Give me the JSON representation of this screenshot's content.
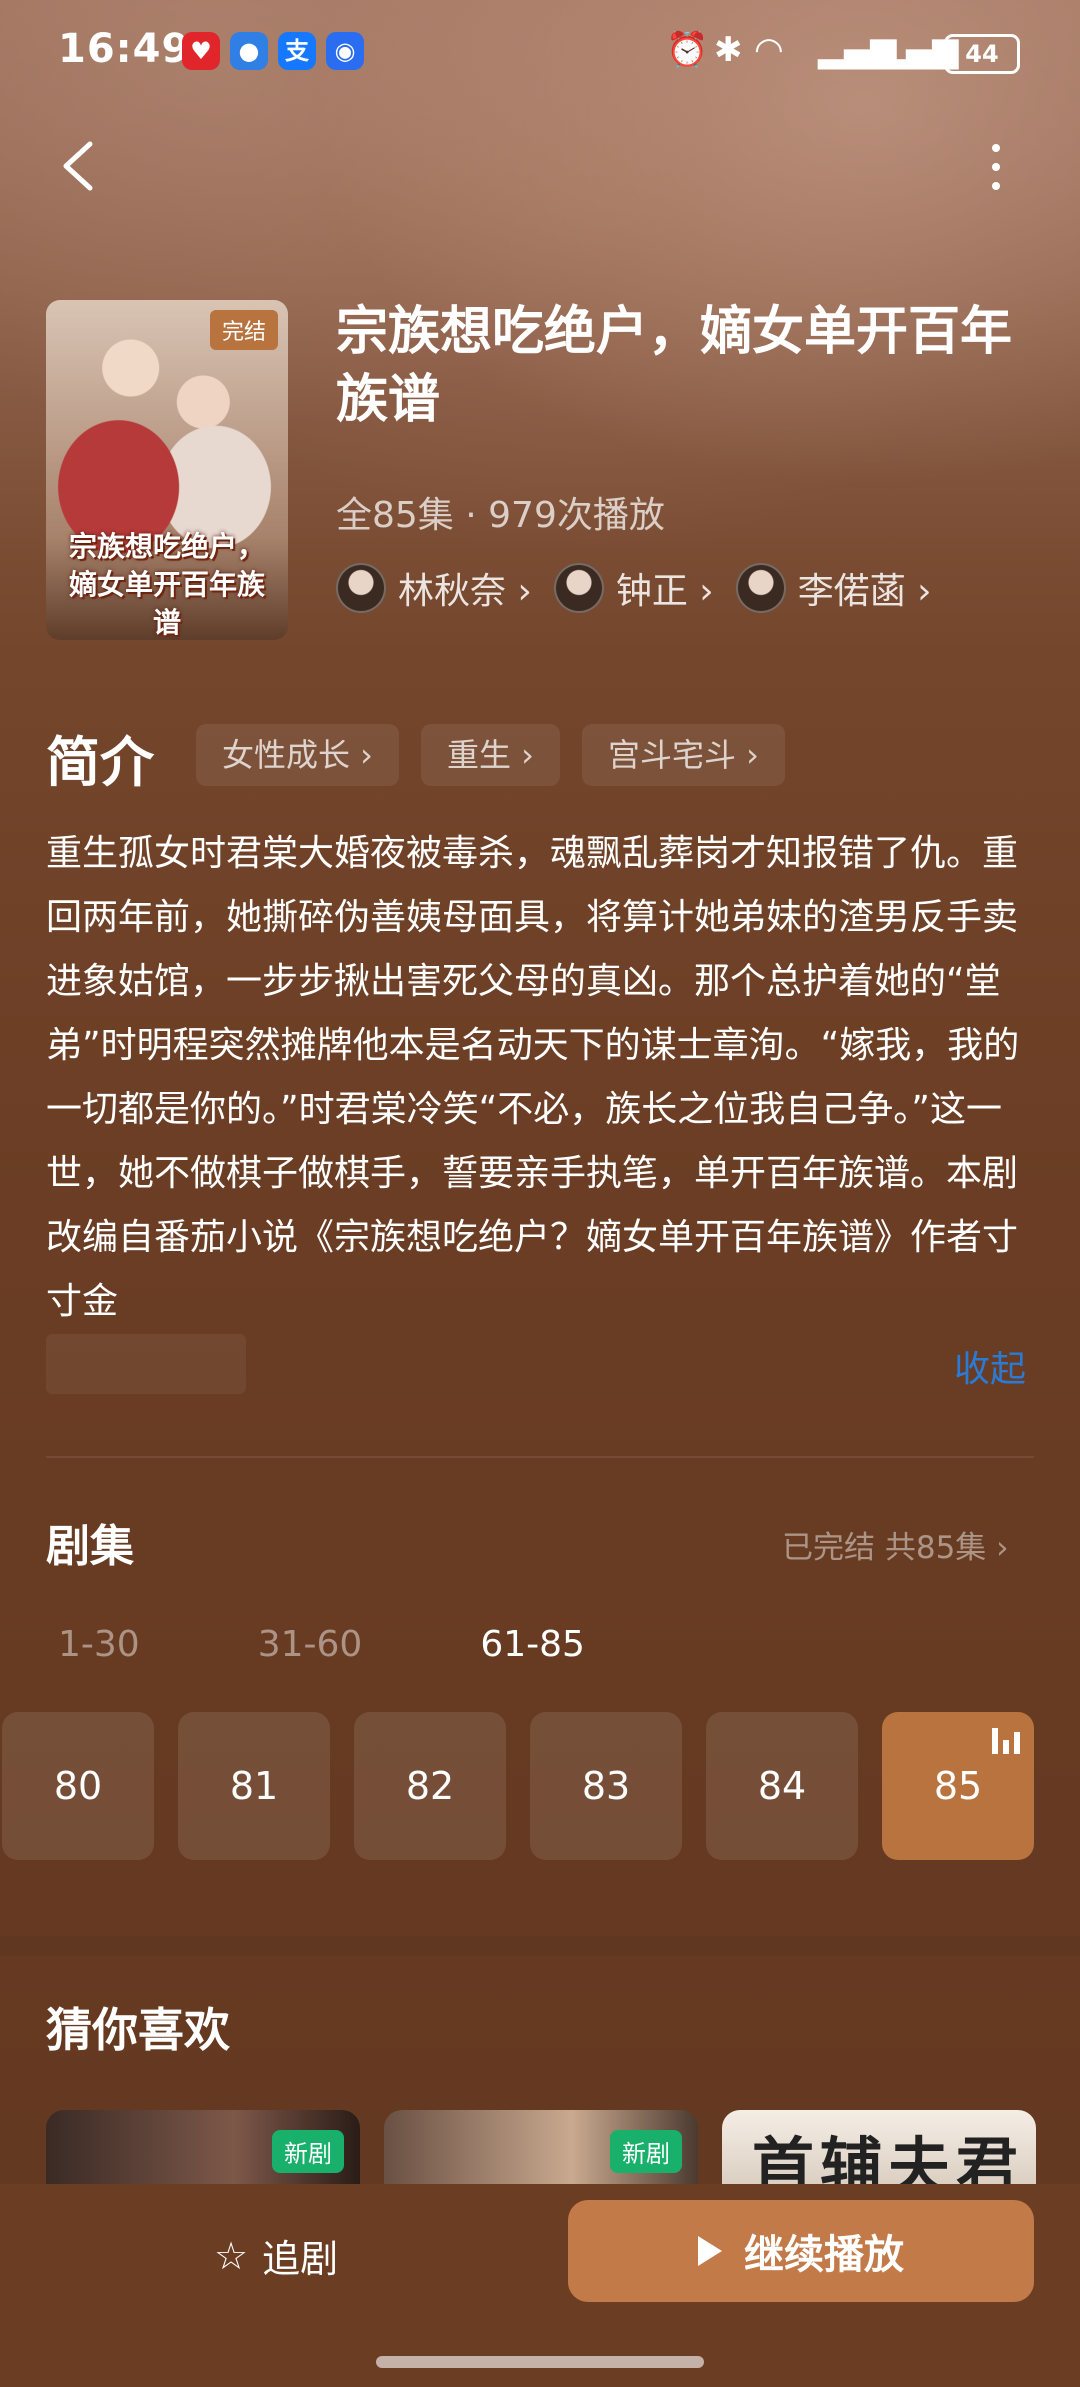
{
  "status_bar": {
    "time": "16:49",
    "app_icons": [
      "pinduoduo-icon",
      "message-icon",
      "alipay-icon",
      "shield-app-icon"
    ],
    "alipay_glyph": "支",
    "battery": "44",
    "system_icons": [
      "alarm-icon",
      "bluetooth-icon",
      "wifi-icon",
      "signal-icon",
      "signal-icon"
    ]
  },
  "drama": {
    "badge": "完结",
    "poster_title": "宗族想吃绝户，嫡女单开百年族谱",
    "title": "宗族想吃绝户，嫡女单开百年族谱",
    "meta": "全85集 · 979次播放",
    "actors": [
      {
        "name": "林秋奈 ›"
      },
      {
        "name": "钟正 ›"
      },
      {
        "name": "李偌菡 ›"
      }
    ]
  },
  "intro": {
    "heading": "简介",
    "tags": [
      "女性成长 ›",
      "重生 ›",
      "宫斗宅斗 ›"
    ],
    "description": "重生孤女时君棠大婚夜被毒杀，魂飘乱葬岗才知报错了仇。重回两年前，她撕碎伪善姨母面具，将算计她弟妹的渣男反手卖进象姑馆，一步步揪出害死父母的真凶。那个总护着她的“堂弟”时明程突然摊牌他本是名动天下的谋士章洵。“嫁我，我的一切都是你的。”时君棠冷笑“不必，族长之位我自己争。”这一世，她不做棋子做棋手，誓要亲手执笔，单开百年族谱。本剧改编自番茄小说《宗族想吃绝户？嫡女单开百年族谱》作者寸寸金",
    "collapse_label": "收起"
  },
  "episodes": {
    "heading": "剧集",
    "status": "已完结 共85集 ›",
    "ranges": [
      "1-30",
      "31-60",
      "61-85"
    ],
    "active_range": "61-85",
    "items": [
      "80",
      "81",
      "82",
      "83",
      "84",
      "85"
    ],
    "active_episode": "85"
  },
  "recommend": {
    "heading": "猜你喜欢",
    "items": [
      {
        "badge": "新剧"
      },
      {
        "badge": "新剧"
      },
      {
        "title": "首辅夫君"
      }
    ]
  },
  "bottom": {
    "follow_label": "追剧",
    "play_label": "继续播放"
  },
  "colors": {
    "accent": "#c27a49",
    "link": "#2b7bd6",
    "new_badge": "#18b06a"
  }
}
